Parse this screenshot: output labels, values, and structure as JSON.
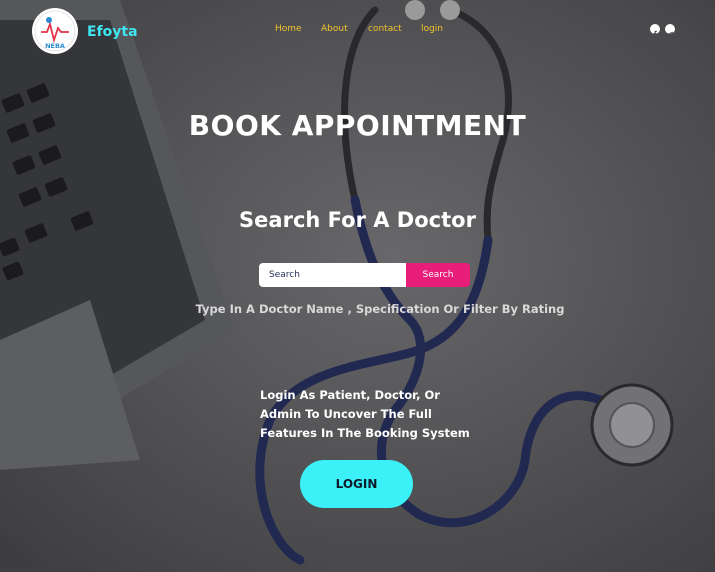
{
  "header": {
    "brand": "Efoyta",
    "logo_text": "NEBA",
    "nav": [
      {
        "label": "Home"
      },
      {
        "label": "About"
      },
      {
        "label": "contact"
      },
      {
        "label": "login"
      }
    ],
    "social": [
      "facebook-icon",
      "telegram-icon"
    ]
  },
  "hero": {
    "title": "BOOK APPOINTMENT",
    "subtitle": "Search For A Doctor"
  },
  "search": {
    "placeholder": "Search",
    "button_label": "Search",
    "hint": "Type In A Doctor Name , Specification Or Filter By Rating"
  },
  "promo": {
    "lines": [
      "Login As Patient, Doctor, Or",
      "Admin To Uncover The Full",
      "Features  In The Booking System"
    ],
    "login_label": "LOGIN"
  },
  "colors": {
    "brand": "#3ee6f0",
    "nav": "#f2c230",
    "search_button": "#e91e7a",
    "login_button": "#3bf0f7"
  }
}
